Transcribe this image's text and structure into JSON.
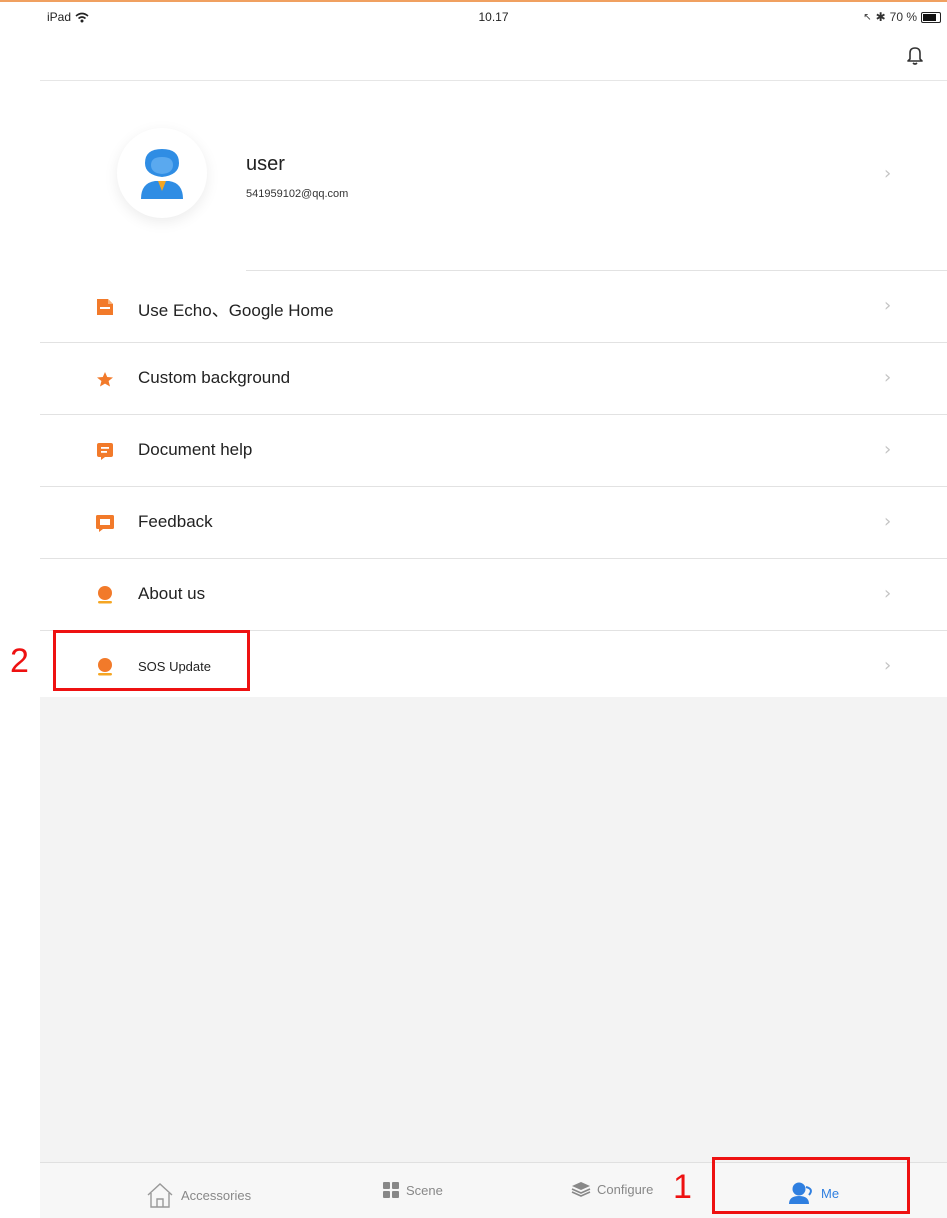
{
  "status_bar": {
    "device": "iPad",
    "time": "10.17",
    "battery": "70 %"
  },
  "profile": {
    "name": "user",
    "email": "541959102@qq.com"
  },
  "menu": [
    {
      "label": "Use Echo、Google Home",
      "icon": "document-icon"
    },
    {
      "label": "Custom background",
      "icon": "star-icon"
    },
    {
      "label": "Document help",
      "icon": "help-document-icon"
    },
    {
      "label": "Feedback",
      "icon": "feedback-icon"
    },
    {
      "label": "About us",
      "icon": "person-icon"
    },
    {
      "label": "SOS Update",
      "icon": "person-icon"
    }
  ],
  "tabs": [
    {
      "label": "Accessories",
      "icon": "home-icon",
      "active": false
    },
    {
      "label": "Scene",
      "icon": "grid-icon",
      "active": false
    },
    {
      "label": "Configure",
      "icon": "layers-icon",
      "active": false
    },
    {
      "label": "Me",
      "icon": "user-icon",
      "active": true
    }
  ],
  "annotations": [
    {
      "number": "1",
      "target": "Me tab"
    },
    {
      "number": "2",
      "target": "SOS Update"
    }
  ],
  "colors": {
    "accent_orange": "#f27a2a",
    "active_blue": "#2f7fe0",
    "annotation_red": "#e11111"
  }
}
